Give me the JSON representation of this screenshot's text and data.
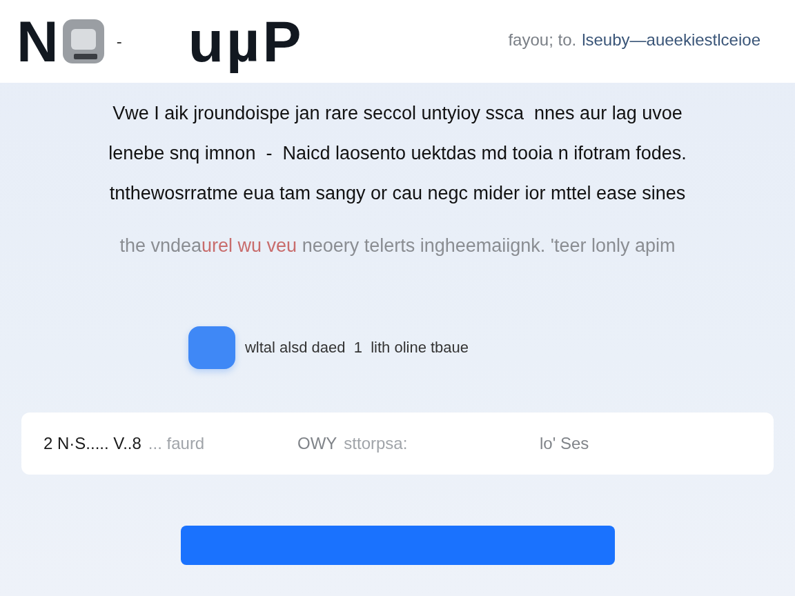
{
  "header": {
    "logo": {
      "letter": "N",
      "dash": "-",
      "word": "uµP"
    },
    "tagline": "fayou; to.",
    "link": "lseuby—aueekiestlceioe"
  },
  "intro": {
    "lines": [
      "Vwe I aik jroundoispe jan rare seccol untyioy ssca  nnes aur lag uvoe",
      "lenebe snq imnon  -  Naicd laosento uektdas md tooia n ifotram fodes.",
      "tnthewosrratme eua tam sangy or cau negc mider ior mttel ease sines"
    ],
    "note": [
      {
        "text": "the vndea",
        "kind": "plain"
      },
      {
        "text": "urel wu veu",
        "kind": "accent"
      },
      {
        "text": " neoery telerts ingheemaiignk. 'teer lonly apim",
        "kind": "plain"
      }
    ]
  },
  "option": {
    "label": "wltal alsd daed  1  lith oline tbaue",
    "checked": true
  },
  "summary": {
    "items": [
      {
        "label": "2 N·S..... V..8",
        "value": "... faurd",
        "kind": "strong"
      },
      {
        "label": "OWY",
        "value": "sttorpsa:",
        "kind": "muted"
      },
      {
        "label": "lo' Ses",
        "kind": "muted"
      }
    ]
  },
  "action_button": {
    "kind": "primary"
  }
}
